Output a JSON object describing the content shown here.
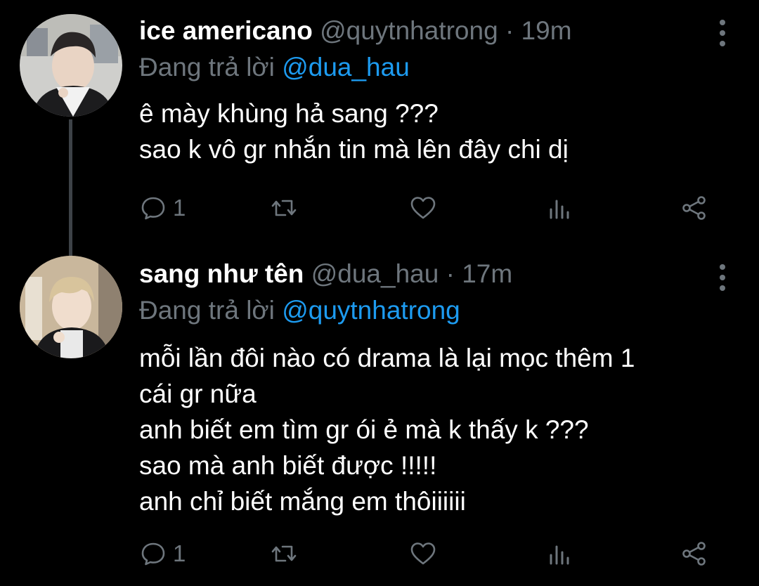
{
  "tweets": [
    {
      "author_name": "ice americano",
      "handle": "@quytnhatrong",
      "separator": "·",
      "time": "19m",
      "reply_prefix": "Đang trả lời",
      "reply_to": "@dua_hau",
      "body_lines": [
        "ê mày khùng hả sang ???",
        "sao k vô gr nhắn tin mà lên đây chi dị"
      ],
      "reply_count": "1",
      "avatar_icon": "user-avatar-photo"
    },
    {
      "author_name": "sang như tên",
      "handle": "@dua_hau",
      "separator": "·",
      "time": "17m",
      "reply_prefix": "Đang trả lời",
      "reply_to": "@quytnhatrong",
      "body_lines": [
        "mỗi lần đôi nào có drama là lại mọc thêm 1",
        "cái gr nữa",
        "anh biết em tìm gr ói ẻ mà k thấy k ???",
        "sao mà anh biết được !!!!!",
        "anh chỉ biết mắng em thôiiiiii"
      ],
      "reply_count": "1",
      "avatar_icon": "user-avatar-photo"
    }
  ],
  "icons": {
    "reply": "reply-icon",
    "retweet": "retweet-icon",
    "like": "like-icon",
    "views": "views-icon",
    "share": "share-icon",
    "more": "more-options-icon"
  },
  "colors": {
    "background": "#000000",
    "text": "#ffffff",
    "muted": "#6e767d",
    "link": "#1d9bf0",
    "thread_line": "#3d4247"
  }
}
